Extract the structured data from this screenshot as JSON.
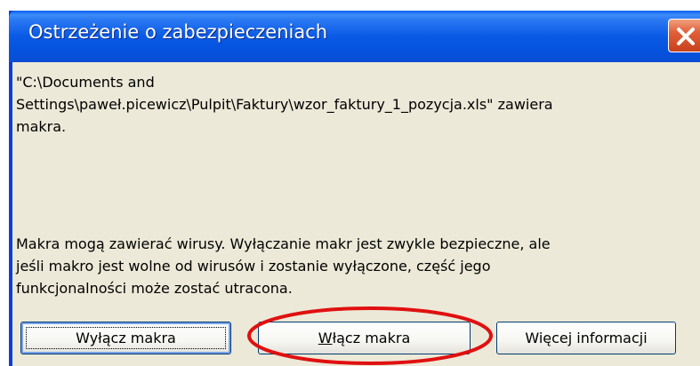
{
  "dialog": {
    "title": "Ostrzeżenie o zabezpieczeniach",
    "close_icon": "close-icon"
  },
  "message": {
    "path_line1": "\"C:\\Documents and",
    "path_line2": "Settings\\paweł.picewicz\\Pulpit\\Faktury\\wzor_faktury_1_pozycja.xls\" zawiera",
    "path_line3": "makra.",
    "warning_line1": "Makra mogą zawierać wirusy. Wyłączanie makr jest zwykle bezpieczne, ale",
    "warning_line2": "jeśli makro jest wolne od wirusów i zostanie wyłączone, część jego",
    "warning_line3": "funkcjonalności może zostać utracona."
  },
  "buttons": {
    "disable_macros": {
      "accel": "",
      "rest": "Wyłącz makra"
    },
    "enable_macros": {
      "accel": "W",
      "rest": "łącz makra"
    },
    "more_info": {
      "accel": "",
      "rest": "Więcej informacji"
    }
  },
  "colors": {
    "title_bar": "#0a5ae6",
    "dialog_bg": "#ece9d8",
    "close_button": "#e0603a",
    "highlight_ellipse": "#e01010"
  }
}
